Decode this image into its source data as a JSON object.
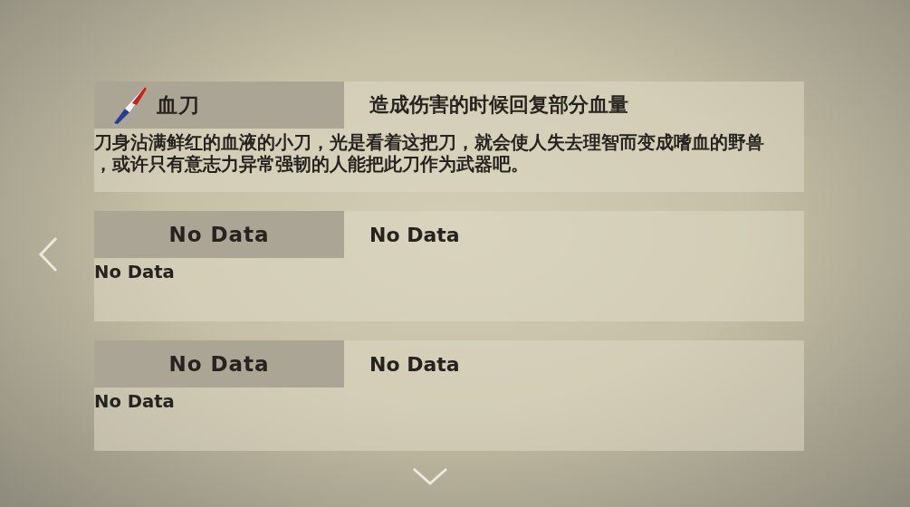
{
  "items": [
    {
      "kind": "item",
      "name": "血刀",
      "effect": "造成伤害的时候回复部分血量",
      "description": "刀身沾满鲜红的血液的小刀，光是看着这把刀，就会使人失去理智而变成嗜血的野兽，或许只有意志力异常强韧的人能把此刀作为武器吧。"
    },
    {
      "kind": "empty",
      "name": "No Data",
      "effect": "No Data",
      "description": "No Data"
    },
    {
      "kind": "empty",
      "name": "No Data",
      "effect": "No Data",
      "description": "No Data"
    }
  ]
}
